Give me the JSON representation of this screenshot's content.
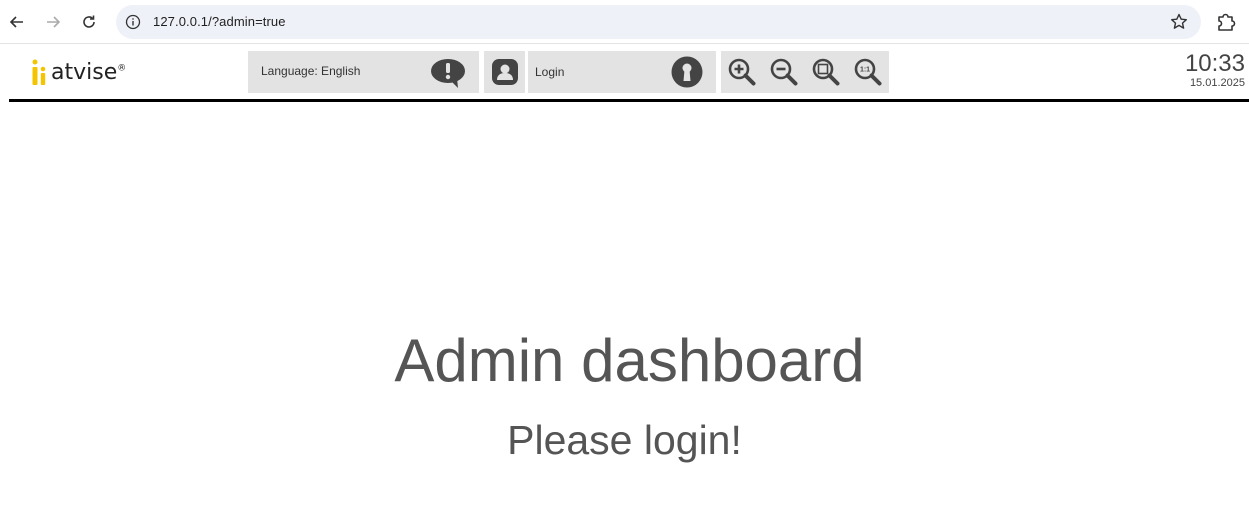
{
  "browser": {
    "url": "127.0.0.1/?admin=true"
  },
  "header": {
    "logo_text": "atvise",
    "logo_mark": "®",
    "language_label": "Language: English",
    "login_label": "Login",
    "time": "10:33",
    "date": "15.01.2025"
  },
  "icons": {
    "language": "speech-bubble-exclamation-icon",
    "user": "user-badge-icon",
    "login": "keyhole-icon",
    "zoom_in": "zoom-in-icon",
    "zoom_out": "zoom-out-icon",
    "zoom_fit": "zoom-fit-icon",
    "zoom_reset": "zoom-1to1-icon"
  },
  "main": {
    "title": "Admin dashboard",
    "subtitle": "Please login!"
  },
  "colors": {
    "panel_bg": "#e3e3e3",
    "icon_dark": "#444444",
    "logo_yellow": "#f5c400",
    "text_gray": "#555555"
  }
}
